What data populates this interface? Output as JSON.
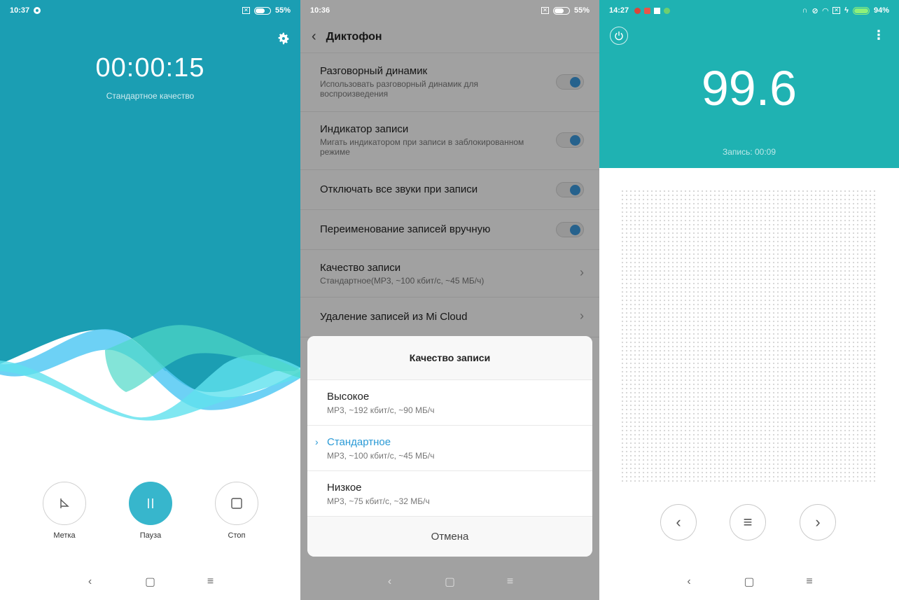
{
  "recorder": {
    "status_time": "10:37",
    "battery": "55%",
    "timer": "00:00:15",
    "quality": "Стандартное качество",
    "controls": {
      "mark": "Метка",
      "pause": "Пауза",
      "stop": "Стоп"
    },
    "colors": {
      "accent": "#1b9eb3",
      "pause_button": "#37b6cc"
    }
  },
  "settings": {
    "status_time": "10:36",
    "battery": "55%",
    "title": "Диктофон",
    "items": [
      {
        "title": "Разговорный динамик",
        "subtitle": "Использовать разговорный динамик для воспроизведения",
        "toggle": true
      },
      {
        "title": "Индикатор записи",
        "subtitle": "Мигать индикатором при записи в заблокированном режиме",
        "toggle": true
      },
      {
        "title": "Отключать все звуки при записи",
        "toggle": true
      },
      {
        "title": "Переименование записей вручную",
        "toggle": true
      },
      {
        "title": "Качество записи",
        "subtitle": "Стандартное(MP3, ~100 кбит/с, ~45 МБ/ч)"
      },
      {
        "title": "Удаление записей из Mi Cloud"
      }
    ],
    "dialog": {
      "title": "Качество записи",
      "options": [
        {
          "title": "Высокое",
          "subtitle": "MP3, ~192 кбит/с, ~90 МБ/ч"
        },
        {
          "title": "Стандартное",
          "subtitle": "MP3, ~100 кбит/с, ~45 МБ/ч",
          "selected": true
        },
        {
          "title": "Низкое",
          "subtitle": "MP3, ~75 кбит/с, ~32 МБ/ч"
        }
      ],
      "cancel": "Отмена"
    }
  },
  "radio": {
    "status_time": "14:27",
    "battery": "94%",
    "frequency": "99.6",
    "recording": "Запись: 00:09",
    "colors": {
      "accent": "#1fb2b2"
    }
  }
}
